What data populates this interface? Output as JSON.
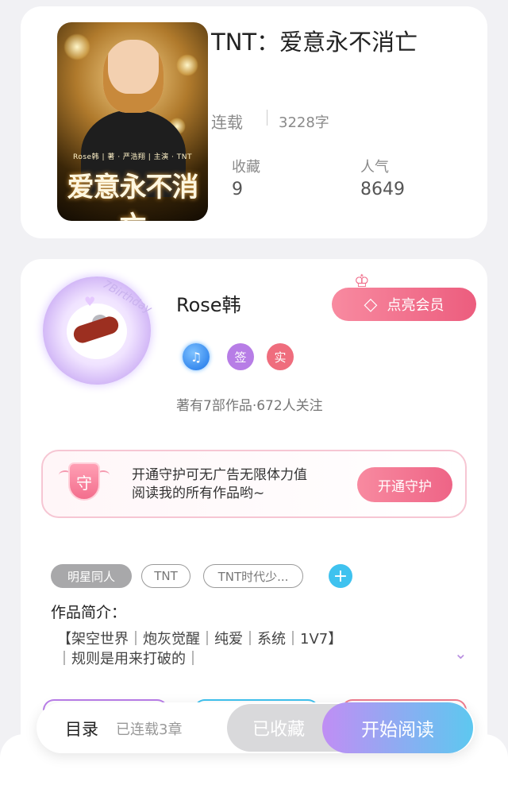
{
  "book": {
    "cover_subtitle": "Rose韩 | 著 · 严浩翔 | 主演 · TNT",
    "cover_title": "爱意永不消亡",
    "title": "TNT：爱意永不消亡",
    "status": "连载",
    "words": "3228字",
    "stats": [
      {
        "label": "收藏",
        "value": "9"
      },
      {
        "label": "人气",
        "value": "8649"
      }
    ]
  },
  "author": {
    "avatar_text": "7Birthday",
    "name": "Rose韩",
    "vip_label": "点亮会员",
    "badges": [
      {
        "icon": "music-note-icon",
        "text": "♫"
      },
      {
        "icon": "sign-badge",
        "text": "签"
      },
      {
        "icon": "real-badge",
        "text": "实"
      }
    ],
    "meta": "著有7部作品·672人关注"
  },
  "guard": {
    "icon_text": "守",
    "text_line1": "开通守护可无广告无限体力值",
    "text_line2": "阅读我的所有作品哟~",
    "button_label": "开通守护"
  },
  "tags": [
    "明星同人",
    "TNT",
    "TNT时代少..."
  ],
  "intro": {
    "label": "作品简介：",
    "line1": "【架空世界｜炮灰觉醒｜纯爱｜系统｜1V7】",
    "line2": "｜规则是用来打破的｜"
  },
  "bottom_bar": {
    "toc_label": "目录",
    "toc_count": "已连载3章",
    "collected_label": "已收藏",
    "read_label": "开始阅读"
  },
  "colors": {
    "accent_pink": "#ee6486",
    "accent_purple": "#c08ef4",
    "accent_blue": "#5dc8f0"
  }
}
